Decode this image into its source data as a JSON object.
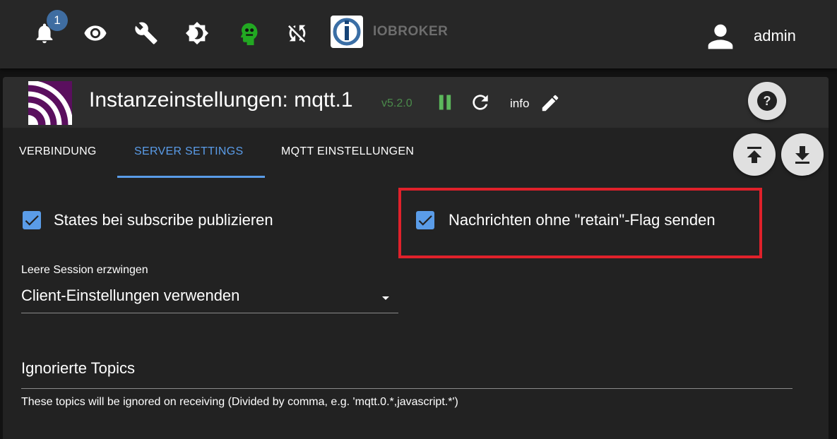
{
  "topbar": {
    "notification_count": "1",
    "brand": "IOBROKER",
    "user": "admin"
  },
  "instance": {
    "title": "Instanzeinstellungen: mqtt.1",
    "version": "v5.2.0",
    "info_label": "info"
  },
  "tabs": [
    {
      "label": "VERBINDUNG",
      "active": false
    },
    {
      "label": "SERVER SETTINGS",
      "active": true
    },
    {
      "label": "MQTT EINSTELLUNGEN",
      "active": false
    }
  ],
  "form": {
    "publish_on_subscribe": {
      "label": "States bei subscribe publizieren",
      "checked": true
    },
    "send_without_retain": {
      "label": "Nachrichten ohne \"retain\"-Flag senden",
      "checked": true
    },
    "force_clean_session": {
      "label": "Leere Session erzwingen",
      "value": "Client-Einstellungen verwenden"
    },
    "ignored_topics": {
      "label": "Ignorierte Topics",
      "value": "",
      "helper": "These topics will be ignored on receiving (Divided by comma, e.g. 'mqtt.0.*,javascript.*')"
    }
  },
  "icons": {
    "notifications": "bell-icon",
    "expert_mode": "eye-icon",
    "system_settings": "wrench-icon",
    "theme": "brightness-icon",
    "admin_head": "head-icon",
    "sync_off": "sync-off-icon",
    "pause": "pause-icon",
    "reload": "reload-icon",
    "edit": "pencil-icon",
    "help": "help-icon",
    "upload": "upload-icon",
    "download": "download-icon"
  },
  "colors": {
    "accent": "#5a9ce8",
    "version_green": "#4b8b4b",
    "pause_green": "#5cb85c",
    "head_green": "#22a822",
    "highlight_red": "#e0212b",
    "topbar_bg": "#272727",
    "panel_bg": "#222222"
  }
}
